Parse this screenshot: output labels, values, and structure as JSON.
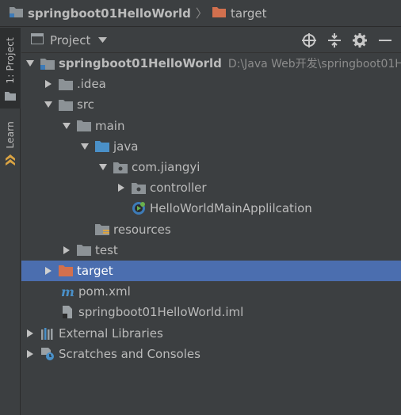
{
  "breadcrumb": {
    "root": "springboot01HelloWorld",
    "current": "target"
  },
  "tool_strip": {
    "project_tab": "1: Project",
    "learn_tab": "Learn"
  },
  "panel": {
    "title": "Project",
    "actions": [
      "locate-icon",
      "collapse-icon",
      "gear-icon",
      "minimize-icon"
    ]
  },
  "tree": {
    "root": {
      "label": "springboot01HelloWorld",
      "path": "D:\\Java Web开发\\springboot01H"
    },
    "idea": ".idea",
    "src": "src",
    "main": "main",
    "java": "java",
    "package": "com.jiangyi",
    "controller": "controller",
    "app_class": "HelloWorldMainApplilcation",
    "resources": "resources",
    "test": "test",
    "target": "target",
    "pom": "pom.xml",
    "iml": "springboot01HelloWorld.iml",
    "external_libraries": "External Libraries",
    "scratches": "Scratches and Consoles"
  },
  "colors": {
    "background": "#3c3f41",
    "selection": "#4b6eaf",
    "folder": "#8c9296",
    "source_folder": "#4a90c8",
    "excluded_folder": "#d2704e"
  }
}
